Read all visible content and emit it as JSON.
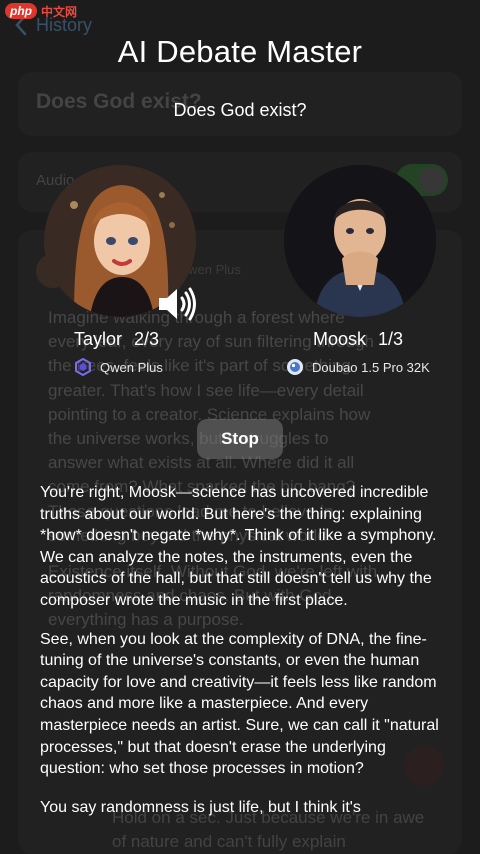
{
  "watermark": {
    "logo": "php",
    "text": "中文网"
  },
  "background": {
    "nav_label": "History",
    "debate_title": "Does God exist?",
    "audio_label": "Audio",
    "message_meta": "Qwen Plus",
    "message_paragraphs": [
      "Imagine walking through a forest where every leaf, every ray of sun filtering through the trees, feels like it's part of something greater. That's how I see life—every detail pointing to a creator. Science explains how the universe works, but it struggles to answer what exists at all. Where did it all come from? What sparked the big bang? Those questions lead me to believe in something beyond the physical world.",
      "Existence itself. Without God, we're left with randomness and chaos. But with God, everything has a purpose."
    ],
    "reply_text": "Hold on a sec. Just because we're in awe of nature and can't fully explain"
  },
  "app": {
    "title": "AI Debate Master",
    "topic": "Does God exist?"
  },
  "debaters": [
    {
      "name": "Taylor",
      "round": "2/3",
      "model": "Qwen Plus",
      "speaking": true
    },
    {
      "name": "Moosk",
      "round": "1/3",
      "model": "Doubao 1.5 Pro 32K",
      "speaking": false
    }
  ],
  "controls": {
    "stop_label": "Stop"
  },
  "speech": {
    "paragraphs": [
      "You're right, Moosk—science has uncovered incredible truths about our world. But here's the thing: explaining *how* doesn't negate *why*. Think of it like a symphony. We can analyze the notes, the instruments, even the acoustics of the hall, but that still doesn't tell us why the composer wrote the music in the first place.",
      "See, when you look at the complexity of DNA, the fine-tuning of the universe's constants, or even the human capacity for love and creativity—it feels less like random chaos and more like a masterpiece. And every masterpiece needs an artist. Sure, we can call it \"natural processes,\" but that doesn't erase the underlying question: who set those processes in motion?",
      "You say randomness is just life, but I think it's"
    ]
  },
  "colors": {
    "background": "#1f1f1f",
    "link_dim": "#4d6b8a",
    "toggle_on": "#315a30",
    "stop_button": "#787878"
  },
  "icons": {
    "back": "chevron-left-icon",
    "speaker": "speaker-wave-icon",
    "qwen": "qwen-logo-icon",
    "doubao": "doubao-logo-icon"
  }
}
